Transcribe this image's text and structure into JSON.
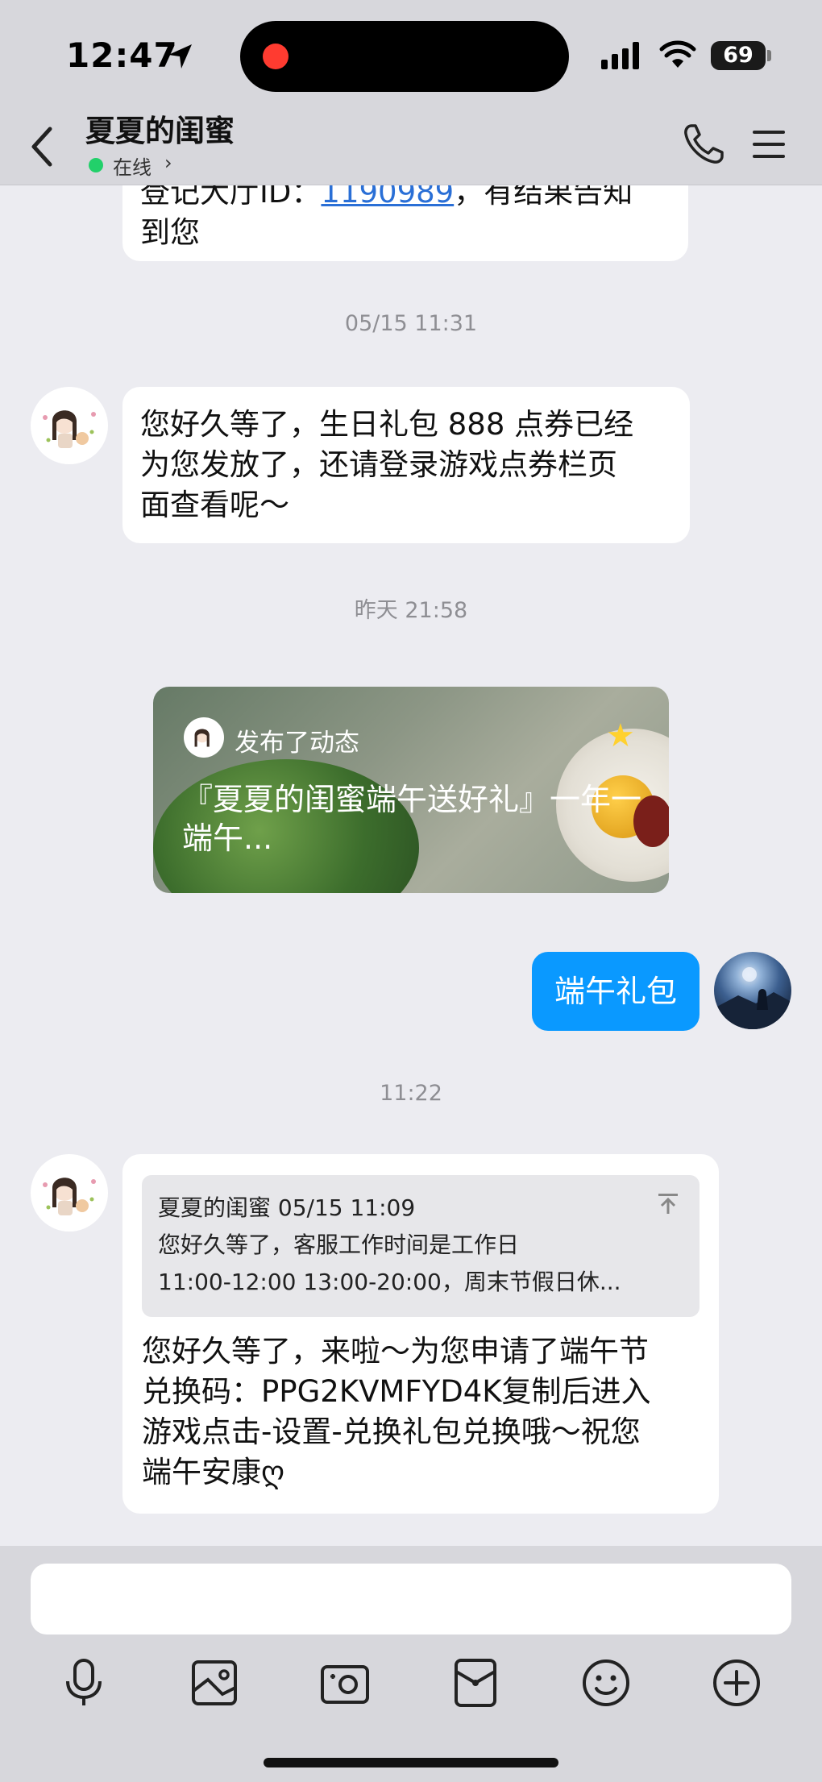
{
  "status_bar": {
    "time": "12:47",
    "battery": "69"
  },
  "header": {
    "title": "夏夏的闺蜜",
    "status": "在线"
  },
  "messages": {
    "m0": {
      "line1": "登记大厅ID：",
      "link": "1190989",
      "line1b": "，有结果告知",
      "line2": "到您"
    },
    "ts1": "05/15 11:31",
    "m1": {
      "lines": [
        "您好久等了，生日礼包 888 点券已经",
        "为您发放了，还请登录游戏点券栏页",
        "面查看呢～"
      ]
    },
    "ts2": "昨天 21:58",
    "card": {
      "publisher": "发布了动态",
      "title": "『夏夏的闺蜜端午送好礼』一年一端午..."
    },
    "m2": {
      "text": "端午礼包"
    },
    "ts3": "11:22",
    "m3": {
      "quote_header": "夏夏的闺蜜 05/15 11:09",
      "quote_line1": "您好久等了，客服工作时间是工作日",
      "quote_line2": "11:00-12:00 13:00-20:00，周末节假日休...",
      "lines": [
        "您好久等了，来啦～为您申请了端午节",
        "兑换码：PPG2KVMFYD4K复制后进入",
        "游戏点击-设置-兑换礼包兑换哦～祝您",
        "端午安康ღ"
      ]
    }
  },
  "toolbar": {
    "tools": [
      "microphone-icon",
      "image-icon",
      "camera-icon",
      "red-packet-icon",
      "emoji-icon",
      "plus-icon"
    ]
  },
  "colors": {
    "accent_blue": "#0a99ff",
    "link": "#2a6fd6",
    "online": "#22d06a"
  }
}
